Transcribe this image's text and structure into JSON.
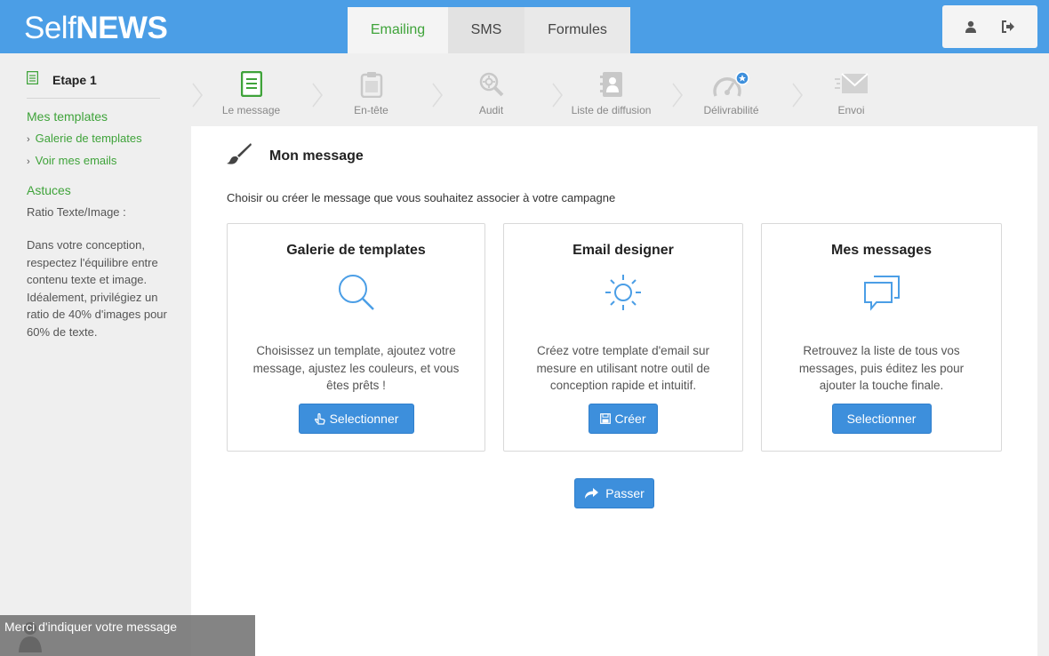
{
  "header": {
    "logo_thin": "Self",
    "logo_bold": "NEWS",
    "tabs": [
      {
        "label": "Emailing",
        "active": true
      },
      {
        "label": "SMS",
        "active": false
      },
      {
        "label": "Formules",
        "active": false
      }
    ],
    "icons": [
      "user-icon",
      "logout-icon"
    ]
  },
  "sidebar": {
    "step_title": "Etape 1",
    "templates_heading": "Mes templates",
    "links": [
      "Galerie de templates",
      "Voir mes emails"
    ],
    "tips_heading": "Astuces",
    "tip_title": "Ratio Texte/Image :",
    "tip_body": "Dans votre conception, respectez l'équilibre entre contenu texte et image. Idéalement, privilégiez un ratio de 40% d'images pour 60% de texte."
  },
  "steps": [
    {
      "label": "Le message",
      "icon": "document-icon",
      "active": true
    },
    {
      "label": "En-tête",
      "icon": "clipboard-icon",
      "active": false
    },
    {
      "label": "Audit",
      "icon": "magnifier-gear-icon",
      "active": false
    },
    {
      "label": "Liste de diffusion",
      "icon": "address-book-icon",
      "active": false
    },
    {
      "label": "Délivrabilité",
      "icon": "gauge-icon",
      "active": false
    },
    {
      "label": "Envoi",
      "icon": "envelope-icon",
      "active": false
    }
  ],
  "main": {
    "title": "Mon message",
    "intro": "Choisir ou créer le message que vous souhaitez associer à votre campagne",
    "cards": [
      {
        "title": "Galerie de templates",
        "icon": "search-icon",
        "description": "Choisissez un template, ajoutez votre message, ajustez les couleurs, et vous êtes prêts !",
        "button": "Selectionner",
        "button_icon": "pointer-hand-icon"
      },
      {
        "title": "Email designer",
        "icon": "sun-icon",
        "description": "Créez votre template d'email sur mesure en utilisant notre outil de conception rapide et intuitif.",
        "button": "Créer",
        "button_icon": "save-icon"
      },
      {
        "title": "Mes messages",
        "icon": "chat-bubbles-icon",
        "description": "Retrouvez la liste de tous vos messages, puis éditez les pour ajouter la touche finale.",
        "button": "Selectionner",
        "button_icon": ""
      }
    ],
    "skip_button": "Passer"
  },
  "toast": {
    "text": "Merci d'indiquer votre message"
  },
  "colors": {
    "header_blue": "#4b9ee6",
    "accent_green": "#3fa33a",
    "button_blue": "#3d8fdc",
    "icon_blue": "#4b9ee6"
  }
}
